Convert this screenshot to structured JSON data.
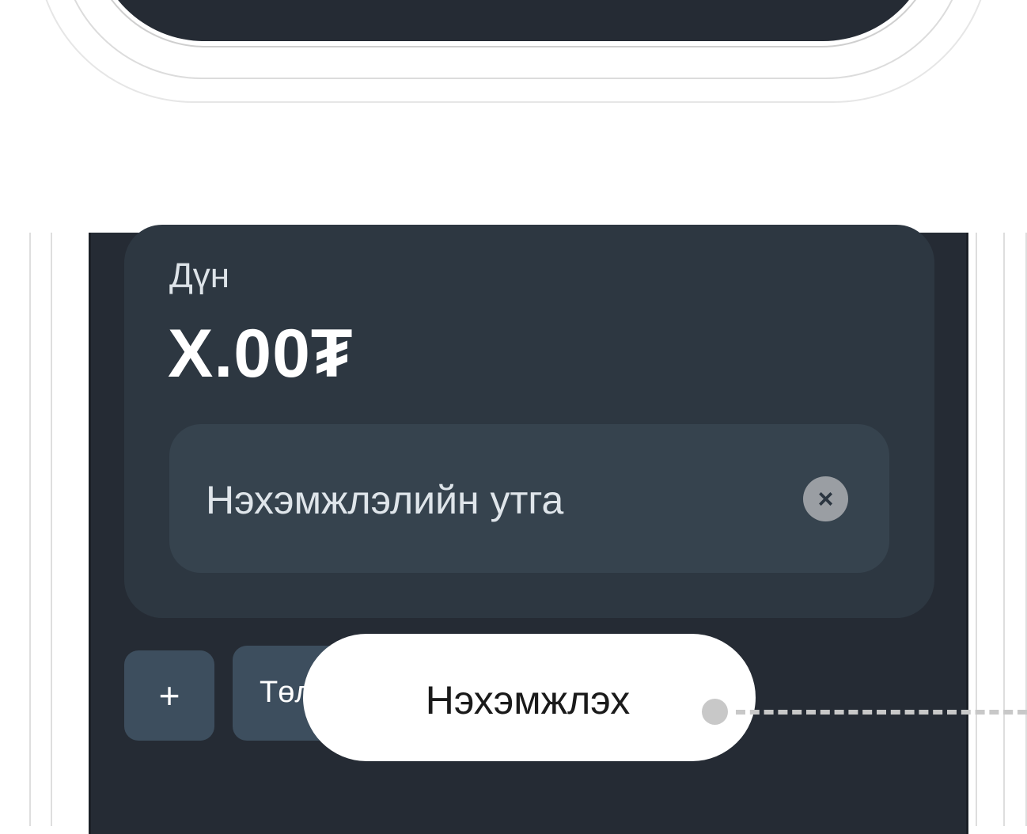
{
  "card": {
    "amount_label": "Дүн",
    "amount_value": "X.00₮"
  },
  "field": {
    "placeholder": "Нэхэмжлэлийн утга",
    "clear_icon": "×"
  },
  "actions": {
    "add_label": "+",
    "pay_label": "Төлөх"
  },
  "callout": {
    "label": "Нэхэмжлэх"
  },
  "colors": {
    "screen_bg": "#252b34",
    "card_bg": "#2d3741",
    "field_bg": "#36434e",
    "button_bg": "#3d4e5e",
    "callout_bg": "#ffffff"
  }
}
